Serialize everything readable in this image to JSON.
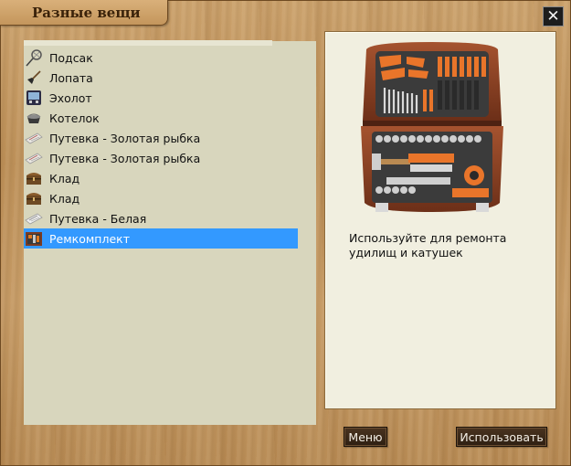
{
  "window": {
    "title": "Разные вещи",
    "close_symbol": "✕"
  },
  "items": [
    {
      "label": "Подсак",
      "icon": "landing-net-icon"
    },
    {
      "label": "Лопата",
      "icon": "shovel-icon"
    },
    {
      "label": "Эхолот",
      "icon": "echo-sounder-icon"
    },
    {
      "label": "Котелок",
      "icon": "pot-icon"
    },
    {
      "label": "Путевка - Золотая рыбка",
      "icon": "voucher-icon"
    },
    {
      "label": "Путевка - Золотая рыбка",
      "icon": "voucher-icon"
    },
    {
      "label": "Клад",
      "icon": "treasure-chest-icon"
    },
    {
      "label": "Клад",
      "icon": "treasure-chest-icon"
    },
    {
      "label": "Путевка - Белая",
      "icon": "voucher-icon"
    },
    {
      "label": "Ремкомплект",
      "icon": "repair-kit-icon",
      "selected": true
    }
  ],
  "details": {
    "image": "toolbox-image",
    "description": "Используйте для ремонта удилищ и катушек"
  },
  "buttons": {
    "menu": "Меню",
    "use": "Использовать"
  },
  "colors": {
    "selection": "#3399ff",
    "list_bg": "#d8d6bd",
    "info_bg": "#f1efe0",
    "button_bg": "#3a2817"
  }
}
